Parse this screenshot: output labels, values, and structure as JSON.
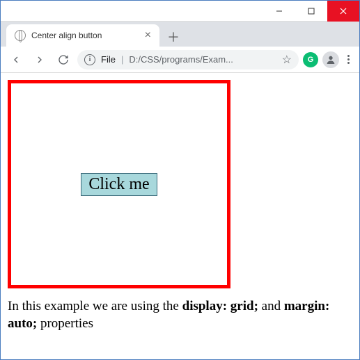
{
  "window": {
    "minimize": "–",
    "maximize": "☐",
    "close": "✕"
  },
  "tab": {
    "title": "Center align button",
    "close": "×",
    "new": "＋"
  },
  "addr": {
    "info": "i",
    "label": "File",
    "sep": "|",
    "path": "D:/CSS/programs/Exam...",
    "star": "☆"
  },
  "ext": {
    "label": "G"
  },
  "page": {
    "button": "Click me",
    "text1": "In this example we are using the ",
    "bold1": "display: grid;",
    "text2": " and ",
    "bold2": "margin: auto;",
    "text3": " properties"
  }
}
